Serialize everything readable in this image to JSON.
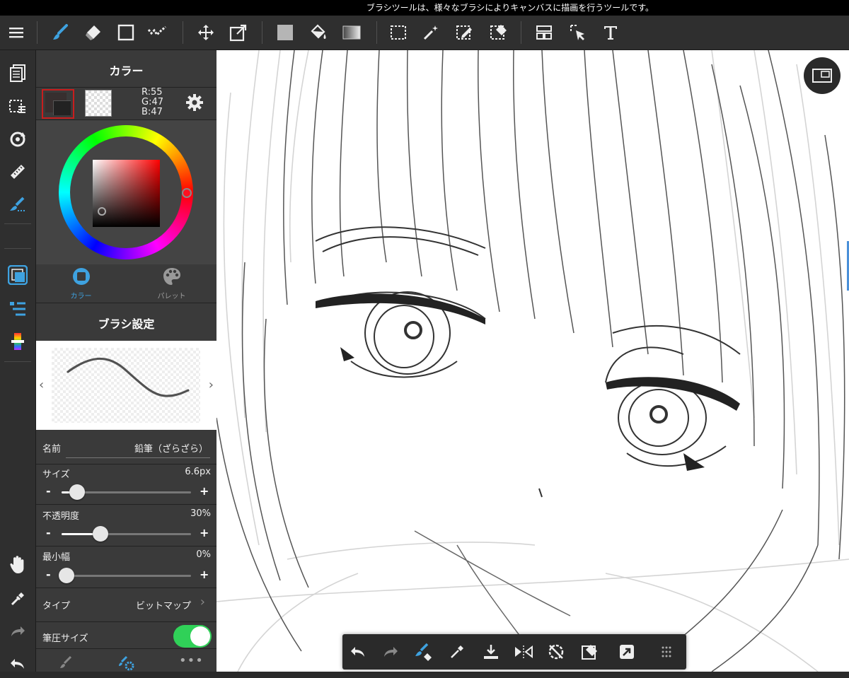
{
  "status_message": "ブラシツールは、様々なブラシによりキャンバスに描画を行うツールです。",
  "toolbar": {
    "icons": [
      "menu-icon",
      "brush-tool-icon",
      "eraser-tool-icon",
      "shape-tool-icon",
      "dot-tool-icon",
      "move-icon",
      "transform-icon",
      "fill-rect-icon",
      "bucket-icon",
      "gradient-icon",
      "select-rect-icon",
      "magic-wand-icon",
      "select-pen-icon",
      "select-eraser-icon",
      "layout-icon",
      "select-move-icon",
      "text-icon"
    ]
  },
  "color_panel": {
    "title": "カラー",
    "r": "R:55",
    "g": "G:47",
    "b": "B:47",
    "foreground": "#372f2f",
    "tabs": [
      {
        "label": "カラー",
        "active": true
      },
      {
        "label": "パレット",
        "active": false
      }
    ]
  },
  "brush_settings": {
    "title": "ブラシ設定",
    "name_label": "名前",
    "name_value": "鉛筆（ざらざら）",
    "size_label": "サイズ",
    "size_value": "6.6px",
    "size_level": 0.12,
    "opacity_label": "不透明度",
    "opacity_value": "30%",
    "opacity_level": 0.3,
    "minwidth_label": "最小幅",
    "minwidth_value": "0%",
    "minwidth_level": 0.0,
    "type_label": "タイプ",
    "type_value": "ビットマップ",
    "pressure_label": "筆圧サイズ",
    "pressure_on": true
  },
  "accent_color": "#3ea2e0",
  "toggle_color": "#30d158"
}
